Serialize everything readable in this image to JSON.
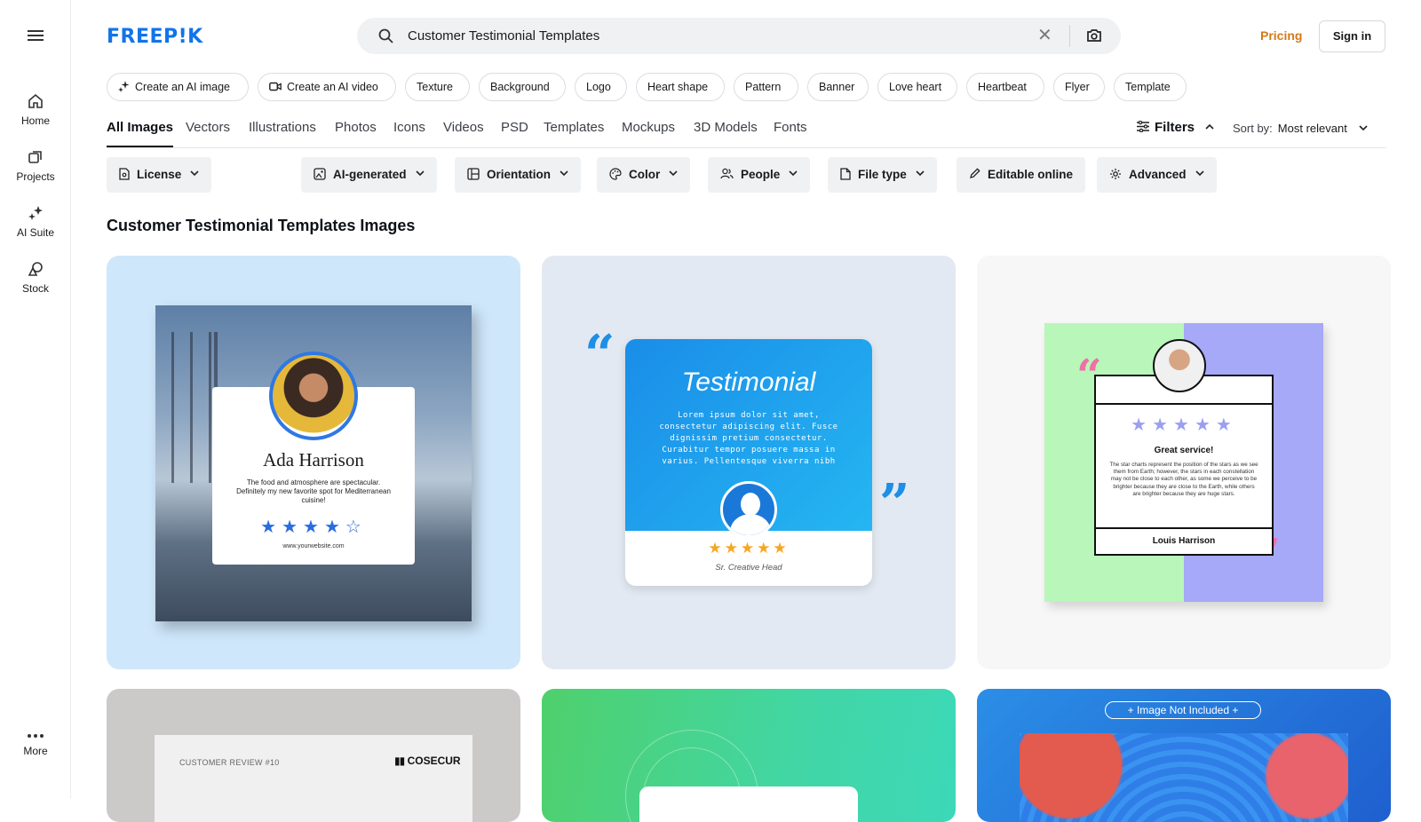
{
  "sidebar": {
    "items": [
      {
        "label": "Home",
        "icon": "home-icon"
      },
      {
        "label": "Projects",
        "icon": "projects-icon"
      },
      {
        "label": "AI Suite",
        "icon": "ai-suite-icon"
      },
      {
        "label": "Stock",
        "icon": "stock-icon"
      }
    ],
    "more_label": "More"
  },
  "header": {
    "logo_text": "FREEP!K",
    "search_value": "Customer Testimonial Templates",
    "pricing_label": "Pricing",
    "signin_label": "Sign in"
  },
  "chips": [
    "Create an AI image",
    "Create an AI video",
    "Texture",
    "Background",
    "Logo",
    "Heart shape",
    "Pattern",
    "Banner",
    "Love heart",
    "Heartbeat",
    "Flyer",
    "Template"
  ],
  "tabs": [
    "All Images",
    "Vectors",
    "Illustrations",
    "Photos",
    "Icons",
    "Videos",
    "PSD",
    "Templates",
    "Mockups",
    "3D Models",
    "Fonts"
  ],
  "filters_label": "Filters",
  "sort": {
    "label": "Sort by:",
    "value": "Most relevant"
  },
  "filter_buttons": [
    "License",
    "AI-generated",
    "Orientation",
    "Color",
    "People",
    "File type",
    "Editable online",
    "Advanced"
  ],
  "results_title": "Customer Testimonial Templates Images",
  "cards": {
    "card1": {
      "name": "Ada Harrison",
      "quote": "The food and atmosphere are spectacular. Definitely my new favorite spot for Mediterranean cuisine!",
      "website": "www.yourwebsite.com",
      "rating": 4,
      "max_rating": 5
    },
    "card2": {
      "title": "Testimonial",
      "body": "Lorem ipsum dolor sit amet, consectetur adipiscing elit. Fusce dignissim pretium consectetur. Curabitur tempor posuere massa in varius. Pellentesque viverra nibh",
      "role": "Sr. Creative Head",
      "rating": 5
    },
    "card3": {
      "heading": "Great service!",
      "body": "The star charts represent the position of the stars as we see them from Earth; however, the stars in each constellation may not be close to each other, as some we perceive to be brighter because they are close to the Earth, while others are brighter because they are huge stars.",
      "name": "Louis Harrison",
      "rating": 5
    },
    "card4": {
      "label": "CUSTOMER REVIEW #10",
      "brand": "COSECUR"
    },
    "card6": {
      "badge": "+ Image Not Included +"
    }
  },
  "colors": {
    "brand_blue": "#1273eb",
    "pricing_orange": "#d47a17"
  }
}
